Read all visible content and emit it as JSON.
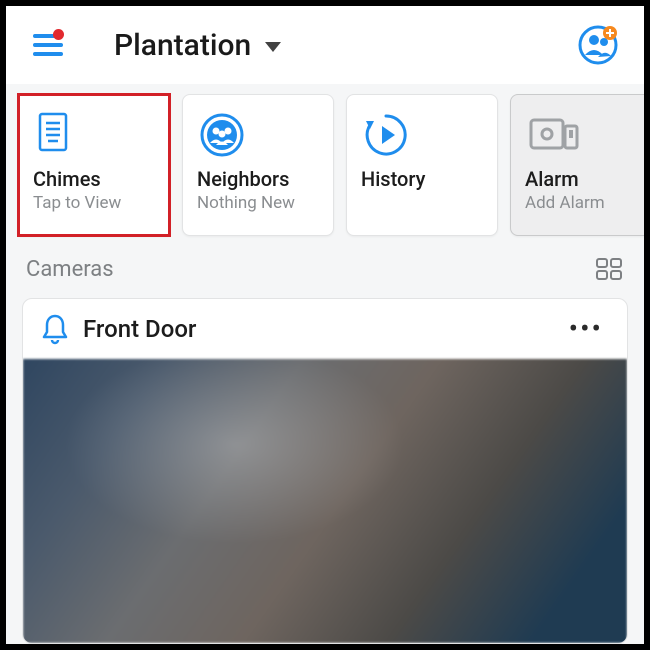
{
  "header": {
    "location_name": "Plantation"
  },
  "cards": [
    {
      "title": "Chimes",
      "subtitle": "Tap to View",
      "icon": "chime",
      "highlight": true,
      "muted": false
    },
    {
      "title": "Neighbors",
      "subtitle": "Nothing New",
      "icon": "neighbors",
      "highlight": false,
      "muted": false
    },
    {
      "title": "History",
      "subtitle": "",
      "icon": "history",
      "highlight": false,
      "muted": false
    },
    {
      "title": "Alarm",
      "subtitle": "Add Alarm",
      "icon": "alarm",
      "highlight": false,
      "muted": true
    }
  ],
  "section": {
    "cameras_label": "Cameras"
  },
  "camera": {
    "name": "Front Door"
  },
  "colors": {
    "accent": "#1f8ded"
  }
}
